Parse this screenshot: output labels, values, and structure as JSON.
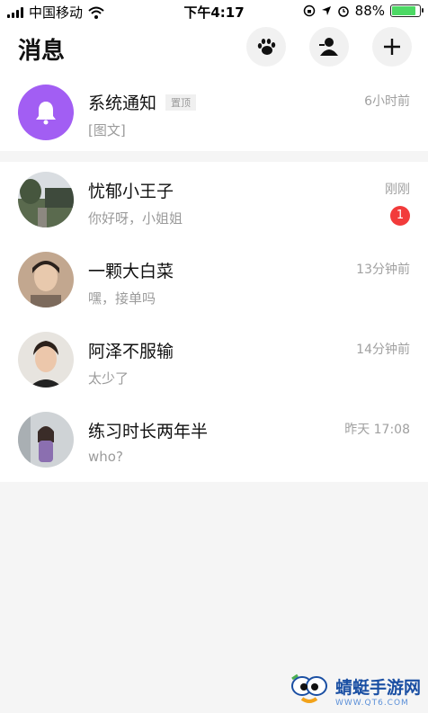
{
  "status_bar": {
    "carrier": "中国移动",
    "time": "下午4:17",
    "battery": "88%",
    "battery_level": 0.88
  },
  "header": {
    "title": "消息",
    "icons": [
      "paw-icon",
      "contacts-icon",
      "add-icon"
    ]
  },
  "system_notice": {
    "name": "系统通知",
    "tag": "置顶",
    "preview": "[图文]",
    "time": "6小时前",
    "icon": "bell-icon",
    "color": "#a25ef3"
  },
  "chats": [
    {
      "name": "忧郁小王子",
      "preview": "你好呀，小姐姐",
      "time": "刚刚",
      "unread": "1"
    },
    {
      "name": "一颗大白菜",
      "preview": "嘿，接单吗",
      "time": "13分钟前"
    },
    {
      "name": "阿泽不服输",
      "preview": "太少了",
      "time": "14分钟前"
    },
    {
      "name": "练习时长两年半",
      "preview": "who?",
      "time": "昨天 17:08"
    }
  ],
  "watermark": {
    "title": "蜻蜓手游网",
    "url": "WWW.QT6.COM"
  },
  "colors": {
    "badge": "#f23b3b",
    "battery": "#4cd964",
    "watermark": "#1a4fa3"
  }
}
